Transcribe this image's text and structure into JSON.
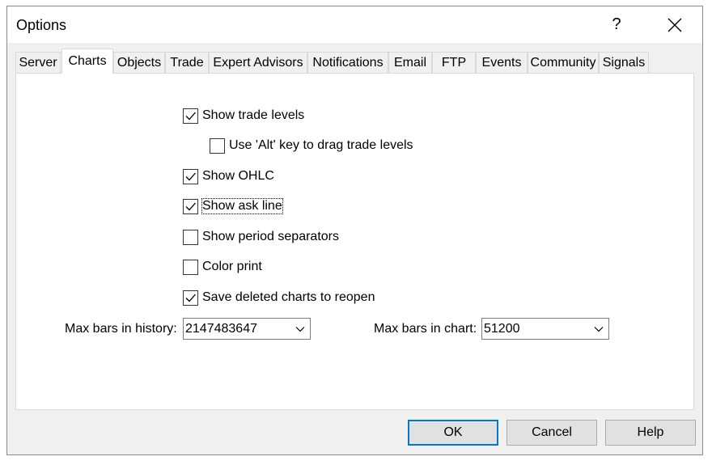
{
  "window": {
    "title": "Options",
    "help_label": "?"
  },
  "tabs": [
    {
      "label": "Server"
    },
    {
      "label": "Charts",
      "active": true
    },
    {
      "label": "Objects"
    },
    {
      "label": "Trade"
    },
    {
      "label": "Expert Advisors"
    },
    {
      "label": "Notifications"
    },
    {
      "label": "Email"
    },
    {
      "label": "FTP"
    },
    {
      "label": "Events"
    },
    {
      "label": "Community"
    },
    {
      "label": "Signals"
    }
  ],
  "options": {
    "show_trade_levels": {
      "label": "Show trade levels",
      "checked": true
    },
    "alt_drag": {
      "label": "Use 'Alt' key to drag trade levels",
      "checked": false
    },
    "show_ohlc": {
      "label": "Show OHLC",
      "checked": true
    },
    "show_ask_line": {
      "label": "Show ask line",
      "checked": true
    },
    "show_period_separators": {
      "label": "Show period separators",
      "checked": false
    },
    "color_print": {
      "label": "Color print",
      "checked": false
    },
    "save_deleted_charts": {
      "label": "Save deleted charts to reopen",
      "checked": true
    }
  },
  "fields": {
    "max_bars_history": {
      "label": "Max bars in history:",
      "value": "2147483647"
    },
    "max_bars_chart": {
      "label": "Max bars in chart:",
      "value": "51200"
    }
  },
  "buttons": {
    "ok": "OK",
    "cancel": "Cancel",
    "help": "Help"
  },
  "colors": {
    "accent": "#0078d7",
    "dialog_bg": "#f0f0f0",
    "panel_bg": "#ffffff"
  }
}
